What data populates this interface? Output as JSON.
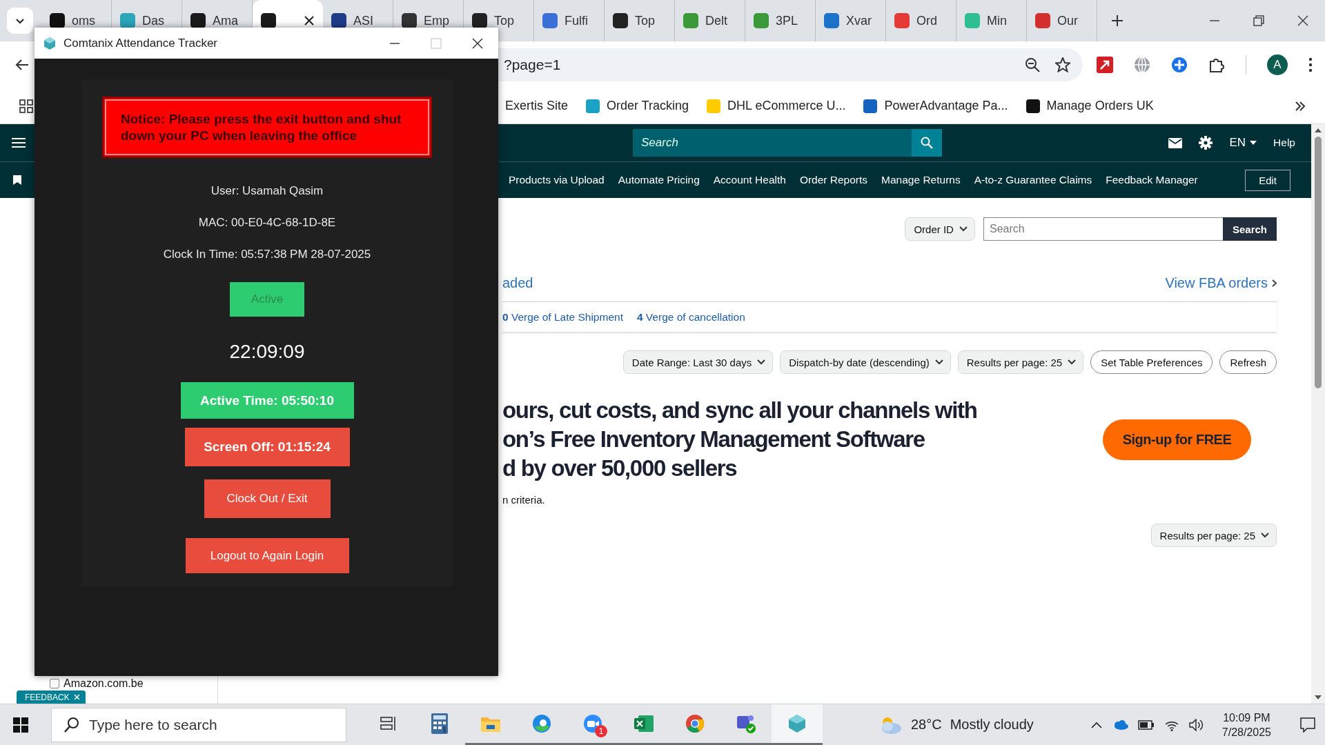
{
  "browser": {
    "tabs": [
      {
        "label": "oms",
        "selected": false,
        "color": "#111111"
      },
      {
        "label": "Das",
        "selected": false,
        "color": "#2aa6b8"
      },
      {
        "label": "Ama",
        "selected": false,
        "color": "#1a1a1a"
      },
      {
        "selected": true,
        "color": "#1a1a1a"
      },
      {
        "label": "ASI",
        "selected": false,
        "color": "#1f3c88"
      },
      {
        "label": "Emp",
        "selected": false,
        "color": "#333333"
      },
      {
        "label": "Top",
        "selected": false,
        "color": "#222222"
      },
      {
        "label": "Fulfi",
        "selected": false,
        "color": "#3a6fd8"
      },
      {
        "label": "Top",
        "selected": false,
        "color": "#222222"
      },
      {
        "label": "Delt",
        "selected": false,
        "color": "#3a9a3a"
      },
      {
        "label": "3PL",
        "selected": false,
        "color": "#3a9a3a"
      },
      {
        "label": "Xvar",
        "selected": false,
        "color": "#1a73c8"
      },
      {
        "label": "Ord",
        "selected": false,
        "color": "#e53935"
      },
      {
        "label": "Min",
        "selected": false,
        "color": "#2ebf91"
      },
      {
        "label": "Our",
        "selected": false,
        "color": "#d32f2f"
      }
    ],
    "address": "?page=1",
    "bookmarks": [
      {
        "label": "Exertis Site"
      },
      {
        "label": "Order Tracking",
        "color": "#1aa3c4"
      },
      {
        "label": "DHL eCommerce U...",
        "color": "#ffcc00"
      },
      {
        "label": "PowerAdvantage Pa...",
        "color": "#1565c0"
      },
      {
        "label": "Manage Orders UK",
        "color": "#111111"
      }
    ],
    "profile_initial": "A"
  },
  "site": {
    "search_placeholder": "Search",
    "language": "EN",
    "help": "Help",
    "nav": [
      "Products via Upload",
      "Automate Pricing",
      "Account Health",
      "Order Reports",
      "Manage Returns",
      "A-to-z Guarantee Claims",
      "Feedback Manager"
    ],
    "edit": "Edit",
    "order_search": {
      "filter": "Order ID",
      "placeholder": "Search",
      "button": "Search"
    },
    "tab_fragment": "aded",
    "fba_link": "View FBA orders",
    "verge": [
      "**0** Verge of Late Shipment",
      "**4** Verge of cancellation"
    ],
    "filters": [
      {
        "kind": "dropdown",
        "label": "Date Range: Last 30 days"
      },
      {
        "kind": "dropdown",
        "label": "Dispatch-by date (descending)"
      },
      {
        "kind": "dropdown",
        "label": "Results per page: 25"
      },
      {
        "kind": "button",
        "label": "Set Table Preferences"
      },
      {
        "kind": "button",
        "label": "Refresh"
      }
    ],
    "banner": {
      "headline_lines": [
        "ours, cut costs, and sync all your channels with",
        "on’s Free Inventory Management Software",
        "d by over 50,000 sellers"
      ],
      "cta": "Sign-up for FREE"
    },
    "criteria_text": "n criteria.",
    "results_per_page": "Results per page: 25",
    "sidebar_item": {
      "label": "Amazon.com.be",
      "checked": false
    },
    "feedback": "FEEDBACK"
  },
  "app_window": {
    "title": "Comtanix Attendance Tracker",
    "notice": "Notice: Please press the exit button and shut down your PC when leaving the office",
    "info": [
      "User: Usamah Qasim",
      "MAC: 00-E0-4C-68-1D-8E",
      "Clock In Time: 05:57:38 PM 28-07-2025"
    ],
    "status": "Active",
    "clock": "22:09:09",
    "counters": [
      {
        "kind": "active",
        "label": "Active Time: 05:50:10"
      },
      {
        "kind": "screen_off",
        "label": "Screen Off: 01:15:24"
      }
    ],
    "actions": [
      "Clock Out / Exit",
      "Logout to Again Login"
    ]
  },
  "taskbar": {
    "search_placeholder": "Type here to search",
    "apps": [
      {
        "running": false,
        "selected": false
      },
      {
        "running": false,
        "selected": false
      },
      {
        "running": true,
        "selected": false
      },
      {
        "running": true,
        "selected": false
      },
      {
        "running": true,
        "selected": false,
        "badge": "1"
      },
      {
        "running": true,
        "selected": false
      },
      {
        "running": true,
        "selected": false
      },
      {
        "running": true,
        "selected": false
      },
      {
        "running": true,
        "selected": true
      }
    ],
    "weather": {
      "temperature": "28°C",
      "condition": "Mostly cloudy"
    },
    "time": "10:09 PM",
    "date": "7/28/2025"
  }
}
